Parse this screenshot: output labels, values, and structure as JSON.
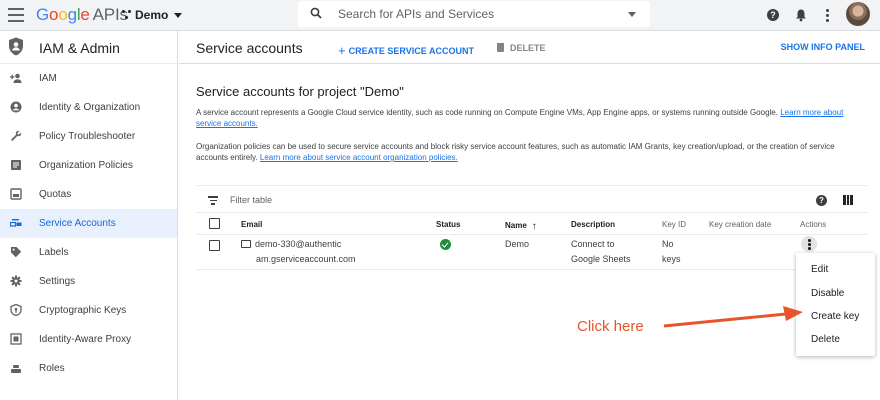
{
  "topbar": {
    "logo_google": [
      "G",
      "o",
      "o",
      "g",
      "l",
      "e"
    ],
    "logo_apis": "APIs",
    "project_name": "Demo",
    "search_placeholder": "Search for APIs and Services",
    "help_glyph": "?"
  },
  "sidebar": {
    "title": "IAM & Admin",
    "items": [
      {
        "label": "IAM",
        "icon": "person-add-icon"
      },
      {
        "label": "Identity & Organization",
        "icon": "account-circle-icon"
      },
      {
        "label": "Policy Troubleshooter",
        "icon": "wrench-icon"
      },
      {
        "label": "Organization Policies",
        "icon": "list-doc-icon"
      },
      {
        "label": "Quotas",
        "icon": "quota-icon"
      },
      {
        "label": "Service Accounts",
        "icon": "service-account-icon",
        "active": true
      },
      {
        "label": "Labels",
        "icon": "label-icon"
      },
      {
        "label": "Settings",
        "icon": "gear-icon"
      },
      {
        "label": "Cryptographic Keys",
        "icon": "shield-key-icon"
      },
      {
        "label": "Identity-Aware Proxy",
        "icon": "proxy-icon"
      },
      {
        "label": "Roles",
        "icon": "roles-icon"
      }
    ]
  },
  "header": {
    "title": "Service accounts",
    "create_label": "CREATE SERVICE ACCOUNT",
    "create_glyph": "+",
    "delete_label": "DELETE",
    "show_info_label": "SHOW INFO PANEL"
  },
  "content": {
    "section_title": "Service accounts for project \"Demo\"",
    "para1_text": "A service account represents a Google Cloud service identity, such as code running on Compute Engine VMs, App Engine apps, or systems running outside Google. ",
    "para1_link": "Learn more about service accounts.",
    "para2_text": "Organization policies can be used to secure service accounts and block risky service account features, such as automatic IAM Grants, key creation/upload, or the creation of service accounts entirely. ",
    "para2_link": "Learn more about service account organization policies."
  },
  "table": {
    "filter_placeholder": "Filter table",
    "help_glyph": "?",
    "headers": {
      "email": "Email",
      "status": "Status",
      "name": "Name",
      "sort_arrow": "↑",
      "description": "Description",
      "key_id": "Key ID",
      "key_creation_date": "Key creation date",
      "actions": "Actions"
    },
    "rows": [
      {
        "email_line1": "demo-330@authentic",
        "email_line2": "am.gserviceaccount.com",
        "status": "enabled",
        "name": "Demo",
        "description_line1": "Connect to",
        "description_line2": "Google Sheets",
        "key_id_line1": "No",
        "key_id_line2": "keys"
      }
    ]
  },
  "menu": {
    "items": [
      "Edit",
      "Disable",
      "Create key",
      "Delete"
    ]
  },
  "annotation": {
    "text": "Click here",
    "color": "#e8542b"
  },
  "colors": {
    "accent": "#1a73e8",
    "active_bg": "#e8f0fe",
    "status_ok": "#1e8e3e"
  }
}
